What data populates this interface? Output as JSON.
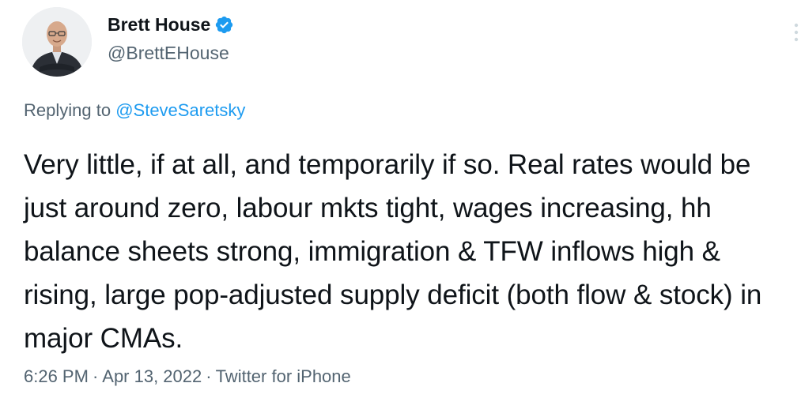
{
  "author": {
    "display_name": "Brett House",
    "handle": "@BrettEHouse",
    "verified": true
  },
  "reply": {
    "prefix": "Replying to",
    "target": "@SteveSaretsky"
  },
  "tweet": {
    "text": "Very little, if at all, and temporarily if so. Real rates would be just around zero, labour mkts tight, wages increasing, hh balance sheets strong, immigration & TFW inflows high & rising, large pop-adjusted supply deficit (both flow & stock) in major CMAs."
  },
  "meta": {
    "time": "6:26 PM",
    "separator": "·",
    "date": "Apr 13, 2022",
    "source": "Twitter for iPhone"
  },
  "colors": {
    "accent": "#1d9bf0",
    "secondary_text": "#536471",
    "primary_text": "#0f1419"
  },
  "icons": {
    "verified": "verified-badge-icon",
    "more": "more-options-icon"
  }
}
